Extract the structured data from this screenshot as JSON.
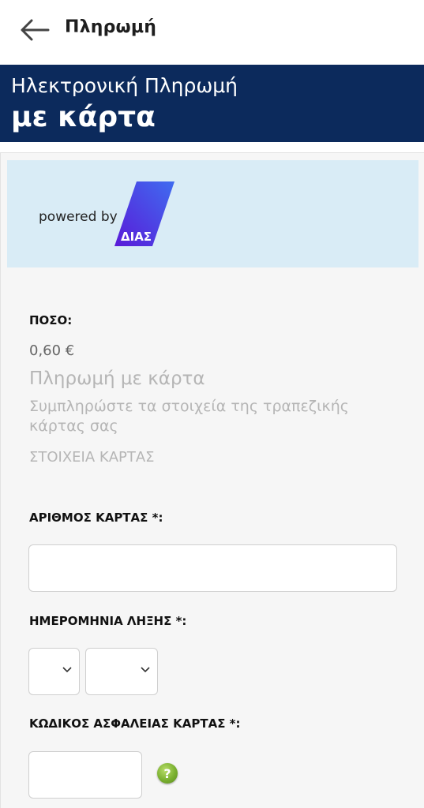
{
  "appbar": {
    "title": "Πληρωμή"
  },
  "banner": {
    "line1": "Ηλεκτρονική Πληρωμή",
    "line2": "με κάρτα"
  },
  "logo": {
    "powered_by": "powered by",
    "brand": "ΔΙΑΣ"
  },
  "payment": {
    "amount_label": "ΠΟΣΟ:",
    "amount_value": "0,60 €",
    "title": "Πληρωμή με κάρτα",
    "description": "Συμπληρώστε τα στοιχεία της τραπεζικής κάρτας σας",
    "section_title": "ΣΤΟΙΧΕΙΑ ΚΑΡΤΑΣ"
  },
  "form": {
    "card_number_label": "ΑΡΙΘΜΟΣ ΚΑΡΤΑΣ *:",
    "card_number_value": "",
    "expiry_label": "ΗΜΕΡΟΜΗΝΙΑ ΛΗΞΗΣ *:",
    "expiry_month_value": "",
    "expiry_year_value": "",
    "cvv_label": "ΚΩΔΙΚΟΣ ΑΣΦΑΛΕΙΑΣ ΚΑΡΤΑΣ *:",
    "cvv_value": "",
    "help_glyph": "?"
  },
  "colors": {
    "banner_bg": "#0c2a5c",
    "logo_bg": "#d9ecf6",
    "help_icon": "#7ab030"
  }
}
